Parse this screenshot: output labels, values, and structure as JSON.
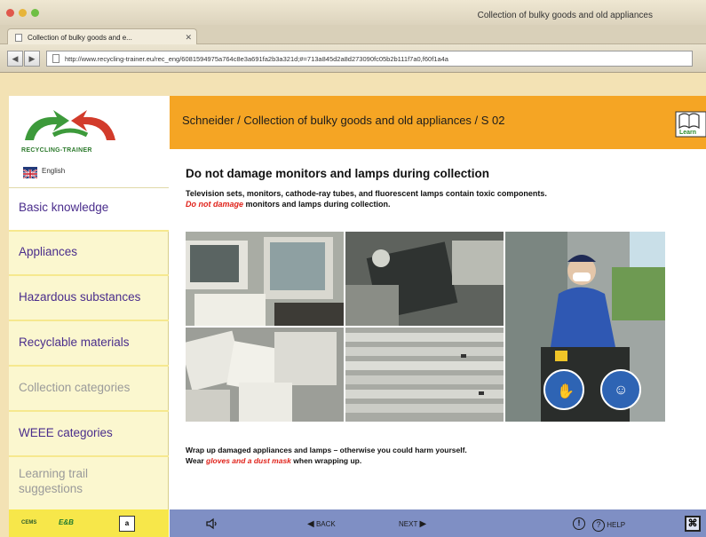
{
  "window": {
    "title": "Collection of bulky goods and old appliances",
    "tab_label": "Collection of bulky goods and e...",
    "url": "http://www.recycling-trainer.eu/rec_eng/6081594975a764c8e3a691fa2b3a321d;#=713a845d2a8d273090fc05b2b111f7a0,f60f1a4a"
  },
  "colors": {
    "header": "#f5a524",
    "sidebar": "#fbf7cf",
    "menu_text": "#4a2d8c",
    "bottom_bar": "#7f8fc4",
    "accent_red": "#e0231b"
  },
  "sidebar": {
    "logo_text": "RECYCLING-TRAINER",
    "language": "English",
    "items": [
      {
        "label": "Basic knowledge",
        "state": "active"
      },
      {
        "label": "Appliances",
        "state": "normal"
      },
      {
        "label": "Hazardous substances",
        "state": "normal"
      },
      {
        "label": "Recyclable materials",
        "state": "normal"
      },
      {
        "label": "Collection categories",
        "state": "disabled"
      },
      {
        "label": "WEEE categories",
        "state": "normal"
      },
      {
        "label": "Learning trail suggestions",
        "state": "disabled"
      }
    ],
    "footer_logos": [
      "CEMS",
      "E&B",
      "a"
    ]
  },
  "header": {
    "breadcrumb": "Schneider / Collection of bulky goods and old appliances / S 02",
    "book_icon_label": "Learn"
  },
  "content": {
    "heading": "Do not damage monitors and lamps during collection",
    "intro_line1": "Television sets, monitors, cathode-ray tubes, and fluorescent lamps contain toxic components.",
    "intro_red": "Do not damage",
    "intro_line2_rest": " monitors and lamps during collection.",
    "note_line1": "Wrap up damaged appliances and lamps – otherwise you could harm yourself.",
    "note_prefix": "Wear ",
    "note_red": "gloves and a dust mask",
    "note_suffix": " when wrapping up."
  },
  "bottom": {
    "sound_icon": "speaker-icon",
    "back": "BACK",
    "next": "NEXT",
    "info_icon": "info-icon",
    "help": "HELP",
    "close_icon": "close-icon"
  }
}
